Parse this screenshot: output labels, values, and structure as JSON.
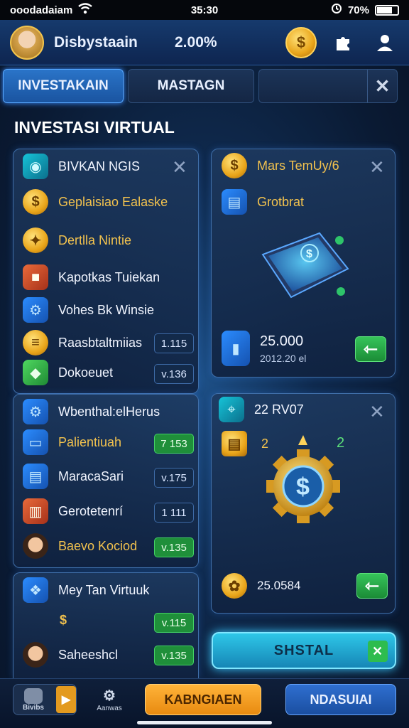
{
  "status_bar": {
    "carrier": "ooodadaiam",
    "time": "35:30",
    "battery": "70%"
  },
  "header": {
    "username": "Disbystaain",
    "percent": "2.00%"
  },
  "tabs": [
    {
      "label": "INVESTAKAIN",
      "active": true
    },
    {
      "label": "MASTAGN",
      "active": false
    }
  ],
  "section_title": "INVESTASI VIRTUAL",
  "panel_a": {
    "title": "BIVKAN NGIS",
    "items": [
      {
        "label": "Geplaisiao Ealaske",
        "icon": "gold-coin-icon",
        "color": "#f2c24e"
      },
      {
        "label": "Dertlla Nintie",
        "icon": "gear-coin-icon",
        "color": "#f2c24e"
      },
      {
        "label": "Kapotkas Tuiekan",
        "icon": "cube-icon",
        "color": "#ffffff"
      },
      {
        "label": "Vohes Bk Winsie",
        "icon": "settings-icon",
        "color": "#ffffff"
      },
      {
        "label": "Raasbtaltmiias",
        "icon": "coin-stack-icon",
        "color": "#ffffff",
        "badge": "1.115"
      },
      {
        "label": "Dokoeuet",
        "icon": "green-box-icon",
        "color": "#ffffff",
        "badge": "v.136"
      }
    ]
  },
  "panel_b": {
    "title": "Wbenthal:elHerus",
    "items": [
      {
        "label": "Palientiuah",
        "icon": "tablet-icon",
        "color": "#f2c24e",
        "badge": "7 153",
        "badge_green": true
      },
      {
        "label": "MaracaSari",
        "icon": "book-icon",
        "color": "#ffffff",
        "badge": "v.175",
        "badge_green": false
      },
      {
        "label": "Gerotetenrí",
        "icon": "books-icon",
        "color": "#ffffff",
        "badge": "1 111",
        "badge_green": false
      },
      {
        "label": "Baevo Kociod",
        "icon": "person-avatar-icon",
        "color": "#f2c24e",
        "badge": "v.135",
        "badge_green": true
      }
    ]
  },
  "panel_c": {
    "items": [
      {
        "label": "Mey Tan Virtuuk",
        "icon": "cubes-icon",
        "color": "#ffffff",
        "badge": "v.115"
      },
      {
        "label": "$",
        "icon": "",
        "color": "#f2c24e",
        "badge": ""
      },
      {
        "label": "Saheeshcl",
        "icon": "person-avatar-icon",
        "color": "#ffffff",
        "badge": "v.135"
      }
    ]
  },
  "card_1": {
    "title": "Mars TemUy/6",
    "subtitle": "Grotbrat",
    "value": "25.000",
    "sub_value": "2012.20 el"
  },
  "card_2": {
    "title": "22 RV07",
    "nums": [
      "2",
      "2"
    ],
    "value": "25.0584"
  },
  "hud_button": "SHSTAL",
  "nav": {
    "home_label": "Bivibs",
    "mid_label": "Aanwas",
    "primary": "KABNGIAEN",
    "secondary": "NDASUIAI"
  }
}
